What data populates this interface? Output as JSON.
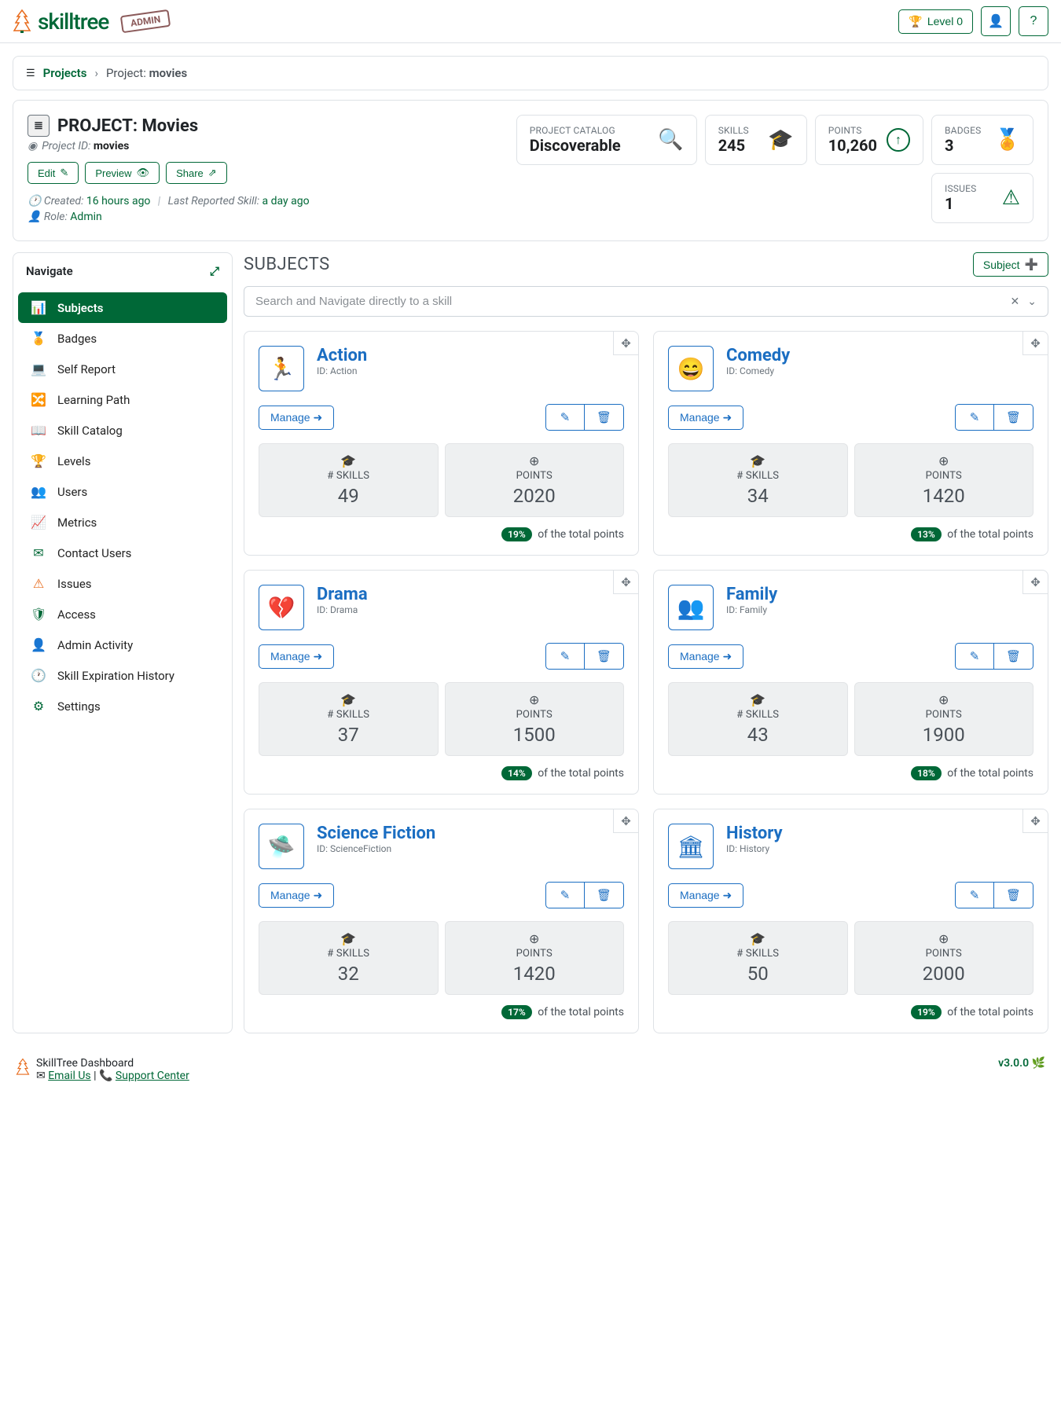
{
  "header": {
    "logo_text": "skilltree",
    "admin_stamp": "ADMIN",
    "level_label": "Level 0",
    "user_icon": "user-icon",
    "help_icon": "?"
  },
  "breadcrumb": {
    "root": "Projects",
    "current_label": "Project: ",
    "current_value": "movies"
  },
  "project": {
    "title": "PROJECT: Movies",
    "id_label": "Project ID",
    "id_value": "movies",
    "buttons": {
      "edit": "Edit",
      "preview": "Preview",
      "share": "Share"
    },
    "created_label": "Created:",
    "created_value": "16 hours ago",
    "last_reported_label": "Last Reported Skill:",
    "last_reported_value": "a day ago",
    "role_label": "Role:",
    "role_value": "Admin"
  },
  "stats": {
    "catalog": {
      "label": "PROJECT CATALOG",
      "value": "Discoverable"
    },
    "skills": {
      "label": "SKILLS",
      "value": "245"
    },
    "points": {
      "label": "POINTS",
      "value": "10,260"
    },
    "badges": {
      "label": "BADGES",
      "value": "3"
    },
    "issues": {
      "label": "ISSUES",
      "value": "1"
    }
  },
  "nav": {
    "title": "Navigate",
    "items": [
      {
        "label": "Subjects",
        "icon": "📊",
        "active": true
      },
      {
        "label": "Badges",
        "icon": "🏅"
      },
      {
        "label": "Self Report",
        "icon": "💻"
      },
      {
        "label": "Learning Path",
        "icon": "🔀"
      },
      {
        "label": "Skill Catalog",
        "icon": "📖"
      },
      {
        "label": "Levels",
        "icon": "🏆",
        "orange": true
      },
      {
        "label": "Users",
        "icon": "👥"
      },
      {
        "label": "Metrics",
        "icon": "📈"
      },
      {
        "label": "Contact Users",
        "icon": "✉"
      },
      {
        "label": "Issues",
        "icon": "⚠",
        "orange": true
      },
      {
        "label": "Access",
        "icon": "🛡"
      },
      {
        "label": "Admin Activity",
        "icon": "👤"
      },
      {
        "label": "Skill Expiration History",
        "icon": "🕐",
        "orange": true
      },
      {
        "label": "Settings",
        "icon": "⚙"
      }
    ]
  },
  "section": {
    "title": "SUBJECTS",
    "add_button": "Subject",
    "search_placeholder": "Search and Navigate directly to a skill"
  },
  "labels": {
    "skills": "# SKILLS",
    "points": "POINTS",
    "manage": "Manage",
    "of_total": "of the total points",
    "id_prefix": "ID: "
  },
  "subjects": [
    {
      "name": "Action",
      "id": "Action",
      "icon": "🏃",
      "skills": "49",
      "points": "2020",
      "pct": "19%"
    },
    {
      "name": "Comedy",
      "id": "Comedy",
      "icon": "😄",
      "skills": "34",
      "points": "1420",
      "pct": "13%"
    },
    {
      "name": "Drama",
      "id": "Drama",
      "icon": "💔",
      "skills": "37",
      "points": "1500",
      "pct": "14%"
    },
    {
      "name": "Family",
      "id": "Family",
      "icon": "👥",
      "skills": "43",
      "points": "1900",
      "pct": "18%"
    },
    {
      "name": "Science Fiction",
      "id": "ScienceFiction",
      "icon": "🛸",
      "skills": "32",
      "points": "1420",
      "pct": "17%"
    },
    {
      "name": "History",
      "id": "History",
      "icon": "🏛",
      "skills": "50",
      "points": "2000",
      "pct": "19%"
    }
  ],
  "footer": {
    "title": "SkillTree Dashboard",
    "email": "Email Us",
    "support": "Support Center",
    "version": "v3.0.0"
  }
}
